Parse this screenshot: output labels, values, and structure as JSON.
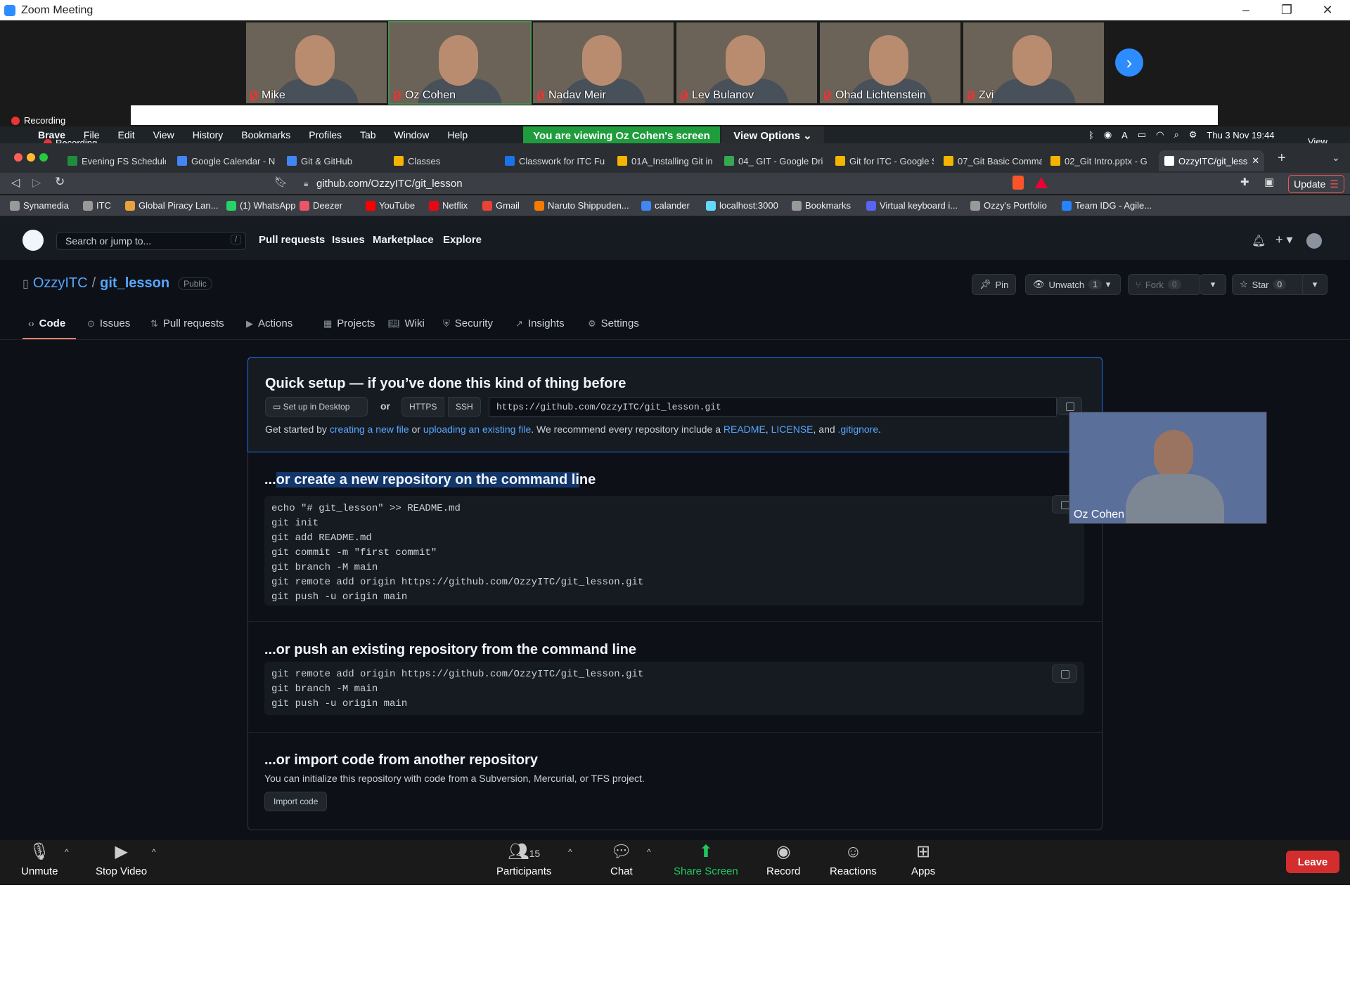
{
  "zoom": {
    "window_title": "Zoom Meeting",
    "recording_label": "Recording",
    "participants": [
      {
        "name": "Mike",
        "active": false
      },
      {
        "name": "Oz Cohen",
        "active": true
      },
      {
        "name": "Nadav Meir",
        "active": false
      },
      {
        "name": "Lev Bulanov",
        "active": false
      },
      {
        "name": "Ohad Lichtenstein",
        "active": false
      },
      {
        "name": "Zvi",
        "active": false
      }
    ],
    "viewing_banner": "You are viewing Oz Cohen's screen",
    "view_options": "View Options",
    "view_right": "View",
    "pip_name": "Oz Cohen",
    "toolbar": {
      "unmute": "Unmute",
      "stop_video": "Stop Video",
      "participants": "Participants",
      "participants_count": "15",
      "chat": "Chat",
      "share_screen": "Share Screen",
      "record": "Record",
      "reactions": "Reactions",
      "apps": "Apps",
      "leave": "Leave"
    }
  },
  "mac_menu": {
    "app": "Brave",
    "items": [
      "File",
      "Edit",
      "View",
      "History",
      "Bookmarks",
      "Profiles",
      "Tab",
      "Window",
      "Help"
    ],
    "datetime": "Thu 3 Nov 19:44",
    "recording_label": "Recording"
  },
  "browser": {
    "tabs": [
      {
        "title": "Evening FS Schedule",
        "color": "#1e8e3e"
      },
      {
        "title": "Google Calendar - N",
        "color": "#4285f4"
      },
      {
        "title": "Git & GitHub",
        "color": "#4285f4"
      },
      {
        "title": "Classes",
        "color": "#f4b400"
      },
      {
        "title": "Classwork for ITC Fu",
        "color": "#1a73e8"
      },
      {
        "title": "01A_Installing Git in",
        "color": "#f4b400"
      },
      {
        "title": "04_ GIT - Google Dri",
        "color": "#34a853"
      },
      {
        "title": "Git for ITC - Google S",
        "color": "#f4b400"
      },
      {
        "title": "07_Git Basic Comma",
        "color": "#f4b400"
      },
      {
        "title": "02_Git Intro.pptx - G",
        "color": "#f4b400"
      },
      {
        "title": "OzzyITC/git_less",
        "color": "#ffffff"
      }
    ],
    "url": "github.com/OzzyITC/git_lesson",
    "update_label": "Update",
    "bookmarks": [
      {
        "label": "Synamedia",
        "color": "#999"
      },
      {
        "label": "ITC",
        "color": "#999"
      },
      {
        "label": "Global Piracy Lan...",
        "color": "#e8a33d"
      },
      {
        "label": "(1) WhatsApp",
        "color": "#25d366"
      },
      {
        "label": "Deezer",
        "color": "#ef5466"
      },
      {
        "label": "YouTube",
        "color": "#ff0000"
      },
      {
        "label": "Netflix",
        "color": "#e50914"
      },
      {
        "label": "Gmail",
        "color": "#ea4335"
      },
      {
        "label": "Naruto Shippuden...",
        "color": "#f57c00"
      },
      {
        "label": "calander",
        "color": "#4285f4"
      },
      {
        "label": "localhost:3000",
        "color": "#61dafb"
      },
      {
        "label": "Bookmarks",
        "color": "#999"
      },
      {
        "label": "Virtual keyboard i...",
        "color": "#5865f2"
      },
      {
        "label": "Ozzy's Portfolio",
        "color": "#999"
      },
      {
        "label": "Team IDG - Agile...",
        "color": "#2684ff"
      }
    ]
  },
  "github": {
    "search_placeholder": "Search or jump to...",
    "search_key": "/",
    "nav": [
      "Pull requests",
      "Issues",
      "Marketplace",
      "Explore"
    ],
    "owner": "OzzyITC",
    "separator": "/",
    "repo": "git_lesson",
    "visibility": "Public",
    "actions": {
      "pin": "Pin",
      "unwatch": "Unwatch",
      "unwatch_count": "1",
      "fork": "Fork",
      "fork_count": "0",
      "star": "Star",
      "star_count": "0"
    },
    "tabs": [
      "Code",
      "Issues",
      "Pull requests",
      "Actions",
      "Projects",
      "Wiki",
      "Security",
      "Insights",
      "Settings"
    ],
    "quick_setup": {
      "title": "Quick setup — if you’ve done this kind of thing before",
      "desktop_button": "Set up in Desktop",
      "or": "or",
      "https": "HTTPS",
      "ssh": "SSH",
      "clone_url": "https://github.com/OzzyITC/git_lesson.git",
      "info_pre": "Get started by ",
      "link_new_file": "creating a new file",
      "info_or": " or ",
      "link_upload": "uploading an existing file",
      "info_mid": ". We recommend every repository include a ",
      "link_readme": "README",
      "comma": ", ",
      "link_license": "LICENSE",
      "and": ", and ",
      "link_gitignore": ".gitignore",
      "period": "."
    },
    "create_section": {
      "title_prefix": "...",
      "title_highlight": "or create a new repository on the command li",
      "title_suffix": "ne",
      "code": "echo \"# git_lesson\" >> README.md\ngit init\ngit add README.md\ngit commit -m \"first commit\"\ngit branch -M main\ngit remote add origin https://github.com/OzzyITC/git_lesson.git\ngit push -u origin main"
    },
    "push_section": {
      "title": "...or push an existing repository from the command line",
      "code": "git remote add origin https://github.com/OzzyITC/git_lesson.git\ngit branch -M main\ngit push -u origin main"
    },
    "import_section": {
      "title": "...or import code from another repository",
      "text": "You can initialize this repository with code from a Subversion, Mercurial, or TFS project.",
      "button": "Import code"
    }
  }
}
